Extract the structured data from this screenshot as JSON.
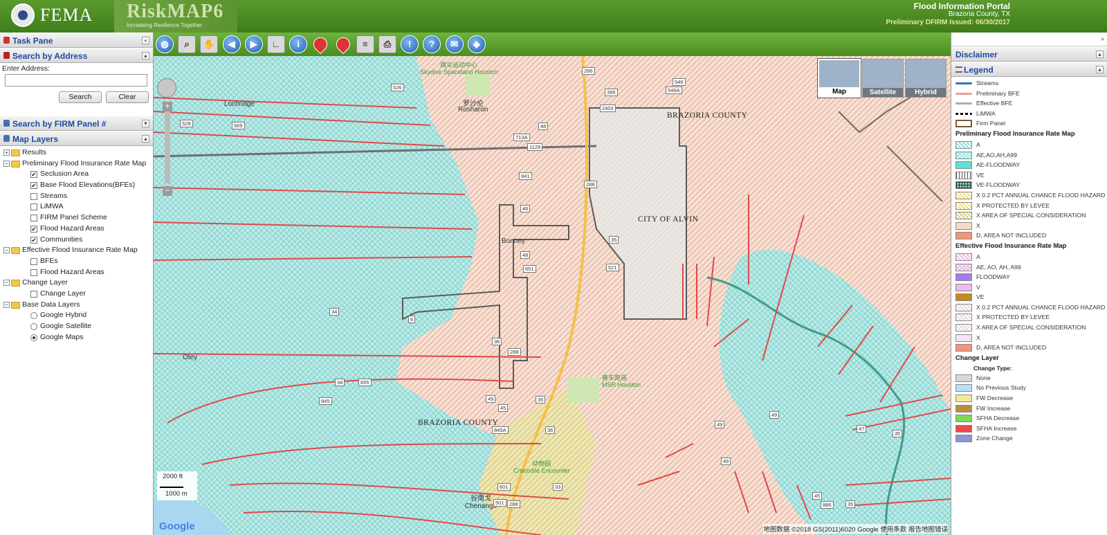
{
  "header": {
    "org_name": "FEMA",
    "app_name": "RiskMAP6",
    "tagline": "Increasing Resilience Together",
    "portal_title": "Flood Information Portal",
    "county": "Brazoria County, TX",
    "issued": "Preliminary DFIRM Issued: 06/30/2017"
  },
  "left": {
    "task_pane": "Task Pane",
    "search_by_address": "Search by Address",
    "enter_address": "Enter Address:",
    "address_value": "",
    "search_button": "Search",
    "clear_button": "Clear",
    "search_by_panel": "Search by FIRM Panel #",
    "map_layers": "Map Layers",
    "tree": [
      {
        "kind": "group",
        "label": "Results",
        "expanded": false
      },
      {
        "kind": "group",
        "label": "Preliminary Flood Insurance Rate Map",
        "expanded": true
      },
      {
        "kind": "check",
        "label": "Seclusion Area",
        "checked": true
      },
      {
        "kind": "check",
        "label": "Base Flood Elevations(BFEs)",
        "checked": true
      },
      {
        "kind": "check",
        "label": "Streams",
        "checked": false
      },
      {
        "kind": "check",
        "label": "LiMWA",
        "checked": false
      },
      {
        "kind": "check",
        "label": "FIRM Panel Scheme",
        "checked": false
      },
      {
        "kind": "check",
        "label": "Flood Hazard Areas",
        "checked": true
      },
      {
        "kind": "check",
        "label": "Communities",
        "checked": true
      },
      {
        "kind": "group",
        "label": "Effective Flood Insurance Rate Map",
        "expanded": true
      },
      {
        "kind": "check",
        "label": "BFEs",
        "checked": false
      },
      {
        "kind": "check",
        "label": "Flood Hazard Areas",
        "checked": false
      },
      {
        "kind": "group",
        "label": "Change Layer",
        "expanded": true
      },
      {
        "kind": "check",
        "label": "Change Layer",
        "checked": false
      },
      {
        "kind": "group",
        "label": "Base Data Layers",
        "expanded": true
      },
      {
        "kind": "radio",
        "label": "Google Hybrid",
        "checked": false
      },
      {
        "kind": "radio",
        "label": "Google Satellite",
        "checked": false
      },
      {
        "kind": "radio",
        "label": "Google Maps",
        "checked": true
      }
    ]
  },
  "toolbar": {
    "tools": [
      "globe-icon",
      "zoom-in-icon",
      "pan-hand-icon",
      "back-icon",
      "forward-icon",
      "measure-icon",
      "info-icon",
      "add-pin-icon",
      "pin-icon",
      "list-icon",
      "print-icon",
      "alert-icon",
      "help-icon",
      "comment-icon",
      "layers-icon"
    ]
  },
  "map": {
    "map_types": [
      "Map",
      "Satellite",
      "Hybrid"
    ],
    "selected_map_type": "Map",
    "labels": {
      "brazoria_top": "BRAZORIA COUNTY",
      "brazoria_bottom": "BRAZORIA COUNTY",
      "city_alvin": "CITY OF ALVIN",
      "lochridge": "Lochridge",
      "bonney": "Bonney",
      "otey": "Otey",
      "rosharon_cn": "罗沙伦",
      "rosharon": "Rosharon",
      "skydive_cn": "跳伞运动中心",
      "skydive": "Skydive Spaceland Houston",
      "msr_cn": "赛车跑道",
      "msr": "MSR Houston",
      "croc_cn": "动物园",
      "croc": "Crocodile Encounter",
      "chenango_cn": "谷南戈",
      "chenango": "Chenango"
    },
    "highways": [
      "526",
      "528",
      "569",
      "286",
      "395",
      "546",
      "546A",
      "2403",
      "48",
      "713A",
      "1128",
      "841",
      "46",
      "288",
      "35",
      "48",
      "651",
      "521",
      "6",
      "36",
      "288",
      "49",
      "45",
      "35",
      "34",
      "34",
      "655",
      "845",
      "845A",
      "36",
      "49",
      "49",
      "47",
      "49",
      "33",
      "601",
      "501",
      "288",
      "45",
      "35",
      "35",
      "886"
    ],
    "scale_ft": "2000 ft",
    "scale_m": "1000 m",
    "google": "Google",
    "attribution": "地图数据 ©2018 GS(2011)6020 Google   使用条款   报告地图错误"
  },
  "right": {
    "disclaimer": "Disclaimer",
    "legend": "Legend",
    "base_items": [
      {
        "label": "Streams",
        "type": "line",
        "color": "#3a6fbf"
      },
      {
        "label": "Preliminary BFE",
        "type": "line",
        "color": "#e99"
      },
      {
        "label": "Effective BFE",
        "type": "line",
        "color": "#aab"
      },
      {
        "label": "LiMWA",
        "type": "dash",
        "color": "#000"
      },
      {
        "label": "Firm Panel",
        "type": "box",
        "color": "#7a5a3a"
      }
    ],
    "prelim_heading": "Preliminary Flood Insurance Rate Map",
    "prelim_items": [
      {
        "label": "A",
        "color": "#7fe3df",
        "pattern": "hatch"
      },
      {
        "label": "AE,AO,AH,A99",
        "color": "#7fe3df",
        "pattern": "cross"
      },
      {
        "label": "AE-FLOODWAY",
        "color": "#5fe0d8",
        "pattern": "solid"
      },
      {
        "label": "VE",
        "color": "#ffffff",
        "pattern": "vert"
      },
      {
        "label": "VE-FLOODWAY",
        "color": "#8fd49a",
        "pattern": "grid"
      },
      {
        "label": "X 0.2 PCT ANNUAL CHANCE FLOOD HAZARD",
        "color": "#f2df7a",
        "pattern": "hatch"
      },
      {
        "label": "X PROTECTED BY LEVEE",
        "color": "#f2df7a",
        "pattern": "hatch"
      },
      {
        "label": "X AREA OF SPECIAL CONSIDERATION",
        "color": "#d8d27a",
        "pattern": "hatch"
      },
      {
        "label": "X",
        "color": "#f6dcc7",
        "pattern": "solid"
      },
      {
        "label": "D, AREA NOT INCLUDED",
        "color": "#f0967a",
        "pattern": "solid"
      }
    ],
    "eff_heading": "Effective Flood Insurance Rate Map",
    "eff_items": [
      {
        "label": "A",
        "color": "#f8b4e3",
        "pattern": "hatch"
      },
      {
        "label": "AE, AO, AH, A99",
        "color": "#f5a0e0",
        "pattern": "cross"
      },
      {
        "label": "FLOODWAY",
        "color": "#a37ce8",
        "pattern": "solid"
      },
      {
        "label": "V",
        "color": "#f3b8ea",
        "pattern": "solid"
      },
      {
        "label": "VE",
        "color": "#c48b1f",
        "pattern": "solid"
      },
      {
        "label": "X 0.2 PCT ANNUAL CHANCE FLOOD HAZARD",
        "color": "#e8d6e4",
        "pattern": "hatch"
      },
      {
        "label": "X PROTECTED BY LEVEE",
        "color": "#e8d6e4",
        "pattern": "hatch"
      },
      {
        "label": "X AREA OF SPECIAL CONSIDERATION",
        "color": "#e8d6e4",
        "pattern": "hatch"
      },
      {
        "label": "X",
        "color": "#f5e4f2",
        "pattern": "solid"
      },
      {
        "label": "D, AREA NOT INCLUDED",
        "color": "#f0967a",
        "pattern": "solid"
      }
    ],
    "change_heading": "Change Layer",
    "change_type": "Change Type:",
    "change_items": [
      {
        "label": "None",
        "color": "#d8d8d8"
      },
      {
        "label": "No Previous Study",
        "color": "#b8e2f4"
      },
      {
        "label": "FW Decrease",
        "color": "#f6e89a"
      },
      {
        "label": "FW Increase",
        "color": "#b8903a"
      },
      {
        "label": "SFHA Decrease",
        "color": "#7ed85a"
      },
      {
        "label": "SFHA Increase",
        "color": "#f04848"
      },
      {
        "label": "Zone Change",
        "color": "#8c95d8"
      }
    ]
  }
}
